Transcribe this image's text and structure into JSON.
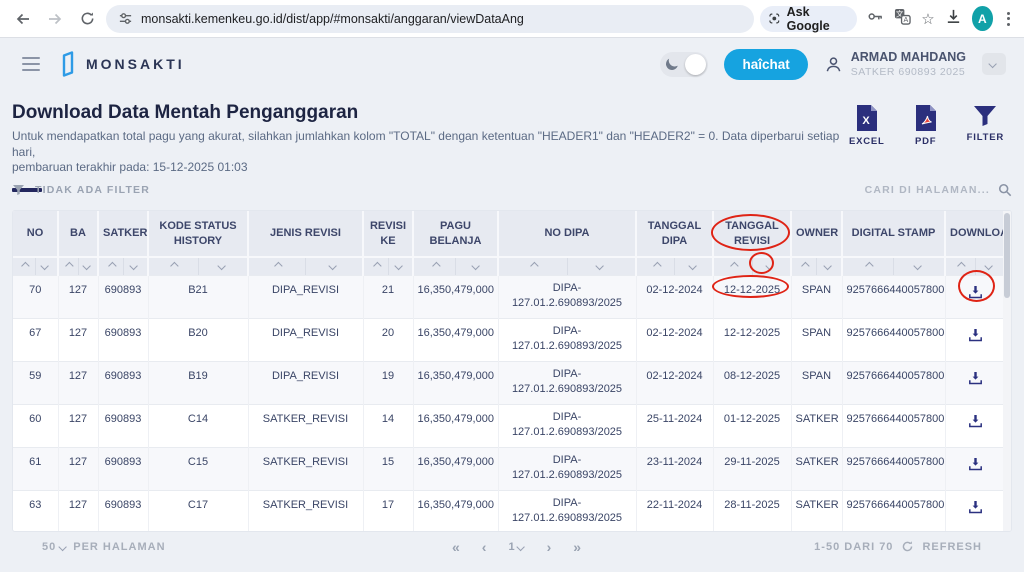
{
  "colors": {
    "accent_navy": "#2b2f7d",
    "brand_blue": "#16a3e0",
    "avatar_teal": "#11a1a8",
    "annotation_red": "#df2315",
    "table_header_bg": "#e7eaf1"
  },
  "browser": {
    "url": "monsakti.kemenkeu.go.id/dist/app/#monsakti/anggaran/viewDataAng",
    "ask_google_label": "Ask Google",
    "avatar_letter": "A"
  },
  "header": {
    "app_name": "MONSAKTI",
    "chat_button_label": "haîchat",
    "user_name": "ARMAD MAHDANG",
    "user_subtitle": "SATKER 690893 2025"
  },
  "page": {
    "title": "Download Data Mentah Penganggaran",
    "subtitle_line1": "Untuk mendapatkan total pagu yang akurat, silahkan jumlahkan kolom \"TOTAL\" dengan ketentuan \"HEADER1\" dan \"HEADER2\" = 0. Data diperbarui setiap hari,",
    "subtitle_line2": "pembaruan terakhir pada: 15-12-2025 01:03",
    "actions": {
      "excel": "EXCEL",
      "pdf": "PDF",
      "filter": "FILTER"
    },
    "filter_status": "TIDAK ADA FILTER",
    "search_placeholder": "CARI DI HALAMAN..."
  },
  "table": {
    "columns": [
      "NO",
      "BA",
      "SATKER",
      "KODE STATUS HISTORY",
      "JENIS REVISI",
      "REVISI KE",
      "PAGU BELANJA",
      "NO DIPA",
      "TANGGAL DIPA",
      "TANGGAL REVISI",
      "OWNER",
      "DIGITAL STAMP",
      "DOWNLOAD"
    ],
    "rows": [
      [
        "70",
        "127",
        "690893",
        "B21",
        "DIPA_REVISI",
        "21",
        "16,350,479,000",
        "DIPA-\n127.01.2.690893/2025",
        "02-12-2024",
        "12-12-2025",
        "SPAN",
        "9257666440057800"
      ],
      [
        "67",
        "127",
        "690893",
        "B20",
        "DIPA_REVISI",
        "20",
        "16,350,479,000",
        "DIPA-\n127.01.2.690893/2025",
        "02-12-2024",
        "12-12-2025",
        "SPAN",
        "9257666440057800"
      ],
      [
        "59",
        "127",
        "690893",
        "B19",
        "DIPA_REVISI",
        "19",
        "16,350,479,000",
        "DIPA-\n127.01.2.690893/2025",
        "02-12-2024",
        "08-12-2025",
        "SPAN",
        "9257666440057800"
      ],
      [
        "60",
        "127",
        "690893",
        "C14",
        "SATKER_REVISI",
        "14",
        "16,350,479,000",
        "DIPA-\n127.01.2.690893/2025",
        "25-11-2024",
        "01-12-2025",
        "SATKER",
        "9257666440057800"
      ],
      [
        "61",
        "127",
        "690893",
        "C15",
        "SATKER_REVISI",
        "15",
        "16,350,479,000",
        "DIPA-\n127.01.2.690893/2025",
        "23-11-2024",
        "29-11-2025",
        "SATKER",
        "9257666440057800"
      ],
      [
        "63",
        "127",
        "690893",
        "C17",
        "SATKER_REVISI",
        "17",
        "16,350,479,000",
        "DIPA-\n127.01.2.690893/2025",
        "22-11-2024",
        "28-11-2025",
        "SATKER",
        "9257666440057800"
      ]
    ]
  },
  "footer": {
    "page_size": "50",
    "per_page_label": "PER HALAMAN",
    "current_page": "1",
    "range_label": "1-50 DARI 70",
    "refresh_label": "REFRESH"
  }
}
